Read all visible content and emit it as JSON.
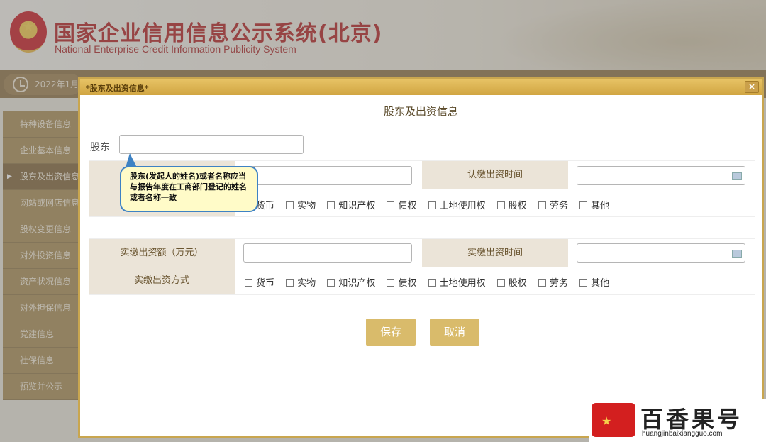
{
  "header": {
    "title_zh": "国家企业信用信息公示系统(北京)",
    "title_en": "National Enterprise Credit Information Publicity System"
  },
  "navbar": {
    "date": "2022年1月"
  },
  "sidebar": {
    "items": [
      {
        "label": "特种设备信息"
      },
      {
        "label": "企业基本信息"
      },
      {
        "label": "股东及出资信息",
        "active": true
      },
      {
        "label": "网站或网店信息"
      },
      {
        "label": "股权变更信息"
      },
      {
        "label": "对外投资信息"
      },
      {
        "label": "资产状况信息"
      },
      {
        "label": "对外担保信息"
      },
      {
        "label": "党建信息"
      },
      {
        "label": "社保信息"
      },
      {
        "label": "预览并公示"
      }
    ]
  },
  "dialog": {
    "title": "*股东及出资信息*",
    "close": "×",
    "form_title": "股东及出资信息",
    "shareholder_label": "股东",
    "shareholder_value": "",
    "tooltip": "股东(发起人的姓名)或者名称应当与报告年度在工商部门登记的姓名或者名称一致",
    "subscribed_time_label": "认缴出资时间",
    "paid_amount_label": "实缴出资额（万元）",
    "paid_time_label": "实缴出资时间",
    "paid_method_label": "实缴出资方式",
    "methods": [
      "货币",
      "实物",
      "知识产权",
      "债权",
      "土地使用权",
      "股权",
      "劳务",
      "其他"
    ],
    "save": "保存",
    "cancel": "取消"
  },
  "watermark": {
    "name": "百香果号",
    "url": "huangjinbaixiangguo.com"
  },
  "colors": {
    "brand_red": "#b11b1b",
    "gold": "#d9bb6b",
    "sidebar": "#a6894f",
    "tooltip_border": "#3e82c4"
  }
}
